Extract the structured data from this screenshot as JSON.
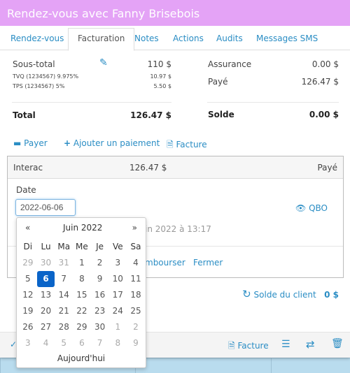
{
  "title": "Rendez-vous avec Fanny Brisebois",
  "tabs": [
    {
      "label": "Rendez-vous"
    },
    {
      "label": "Facturation",
      "active": true
    },
    {
      "label": "Notes"
    },
    {
      "label": "Actions"
    },
    {
      "label": "Audits"
    },
    {
      "label": "Messages SMS"
    }
  ],
  "summary": {
    "subtotal_label": "Sous-total",
    "subtotal": "110 $",
    "tvq_label": "TVQ (1234567) 9.975%",
    "tvq": "10.97 $",
    "tps_label": "TPS (1234567) 5%",
    "tps": "5.50 $",
    "total_label": "Total",
    "total": "126.47 $",
    "insurance_label": "Assurance",
    "insurance": "0.00 $",
    "paid_label": "Payé",
    "paid": "126.47 $",
    "balance_label": "Solde",
    "balance": "0.00 $"
  },
  "actions": {
    "pay": "Payer",
    "add_payment": "Ajouter un paiement",
    "invoice": "Facture"
  },
  "payment": {
    "method": "Interac",
    "amount": "126.47 $",
    "status": "Payé",
    "date_label": "Date",
    "date_value": "2022-06-06",
    "qbo": "QBO",
    "created_fragment": "in 2022 à 13:17",
    "refund_fragment": "mbourser",
    "close": "Fermer"
  },
  "client_balance": {
    "label": "Solde du client",
    "value": "0 $"
  },
  "footer": {
    "invoice": "Facture"
  },
  "datepicker": {
    "prev": "«",
    "next": "»",
    "month": "Juin 2022",
    "today": "Aujourd'hui",
    "weekdays": [
      "Di",
      "Lu",
      "Ma",
      "Me",
      "Je",
      "Ve",
      "Sa"
    ],
    "weeks": [
      [
        "29",
        "30",
        "31",
        "1",
        "2",
        "3",
        "4"
      ],
      [
        "5",
        "6",
        "7",
        "8",
        "9",
        "10",
        "11"
      ],
      [
        "12",
        "13",
        "14",
        "15",
        "16",
        "17",
        "18"
      ],
      [
        "19",
        "20",
        "21",
        "22",
        "23",
        "24",
        "25"
      ],
      [
        "26",
        "27",
        "28",
        "29",
        "30",
        "1",
        "2"
      ],
      [
        "3",
        "4",
        "5",
        "6",
        "7",
        "8",
        "9"
      ]
    ],
    "selected": "6"
  },
  "colors": {
    "header": "#e4a3f6",
    "accent": "#2a8dc4",
    "selected": "#0a64c8"
  }
}
